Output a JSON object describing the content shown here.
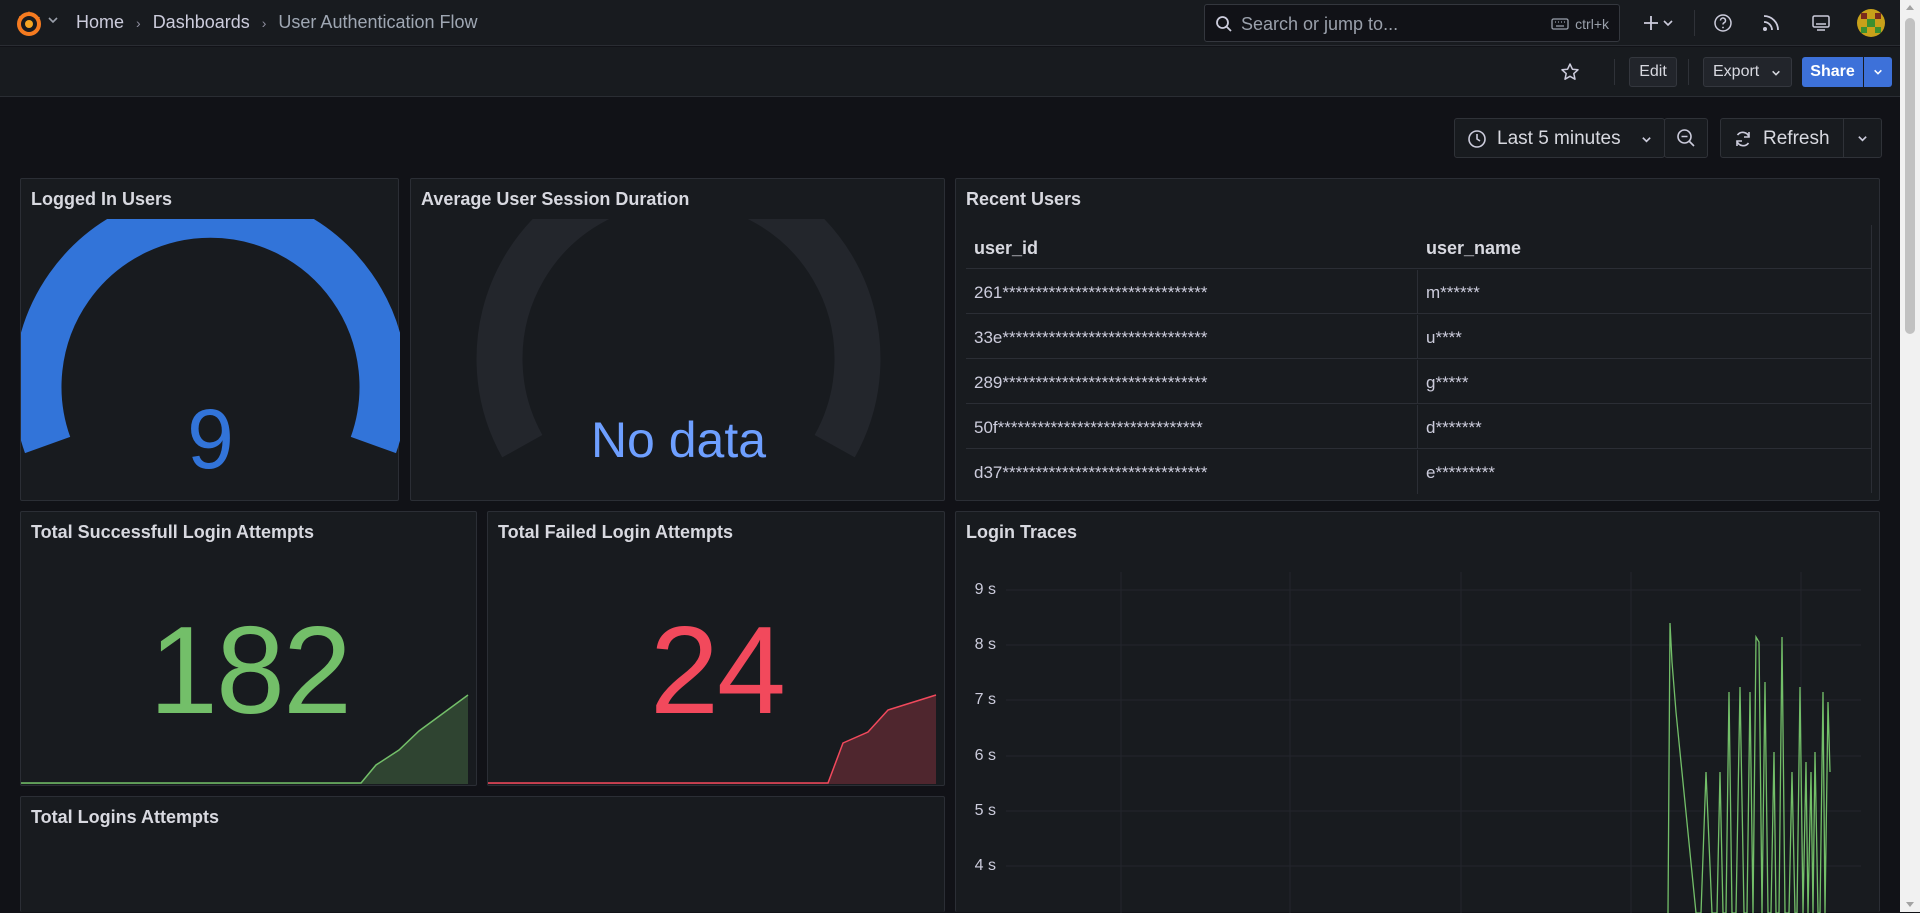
{
  "breadcrumb": {
    "home": "Home",
    "dashboards": "Dashboards",
    "current": "User Authentication Flow"
  },
  "search": {
    "placeholder": "Search or jump to...",
    "shortcut": "ctrl+k"
  },
  "toolbar": {
    "edit": "Edit",
    "export": "Export",
    "share": "Share"
  },
  "time_controls": {
    "range": "Last 5 minutes",
    "refresh": "Refresh"
  },
  "panels": {
    "logged_in": {
      "title": "Logged In Users",
      "value": "9"
    },
    "avg_session": {
      "title": "Average User Session Duration",
      "value": "No data"
    },
    "recent_users": {
      "title": "Recent Users",
      "columns": [
        "user_id",
        "user_name"
      ],
      "rows": [
        [
          "261*******************************",
          "m******"
        ],
        [
          "33e*******************************",
          "u****"
        ],
        [
          "289*******************************",
          "g*****"
        ],
        [
          "50f*******************************",
          "d*******"
        ],
        [
          "d37*******************************",
          "e*********"
        ]
      ]
    },
    "success": {
      "title": "Total Successfull Login Attempts",
      "value": "182"
    },
    "failed": {
      "title": "Total Failed Login Attempts",
      "value": "24"
    },
    "login_traces": {
      "title": "Login Traces",
      "y_ticks": [
        "9 s",
        "8 s",
        "7 s",
        "6 s",
        "5 s",
        "4 s"
      ]
    },
    "total_logins": {
      "title": "Total Logins Attempts"
    }
  },
  "colors": {
    "accent": "#3274d9",
    "success": "#73bf69",
    "failed": "#f2495c",
    "bg": "#111217",
    "panel": "#181b1f"
  }
}
